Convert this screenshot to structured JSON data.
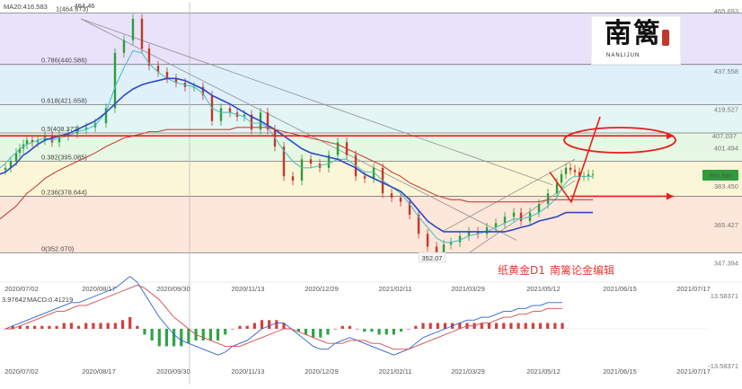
{
  "chart_data": {
    "type": "line",
    "instrument_caption": "纸黄金D1",
    "editor_caption": "南篱论金编辑",
    "logo": {
      "glyph_1": "南",
      "glyph_2": "篱",
      "subtitle": "NANLIJUN"
    },
    "ma_label": "MA20:416.583",
    "x_dates": [
      "2020/07/02",
      "2020/08/17",
      "2020/09/30",
      "2020/11/13",
      "2020/12/29",
      "2021/02/11",
      "2021/03/29",
      "2021/05/12",
      "2021/06/15",
      "2021/07/17"
    ],
    "y_ticks_right": [
      "465.693",
      "437.558",
      "419.527",
      "401.494",
      "383.450",
      "365.427",
      "347.394"
    ],
    "ylim": [
      340,
      470
    ],
    "last_price": "388.560",
    "mark_level": "407.037",
    "peak_label": "464.46",
    "trough_label": "352.07",
    "fib_levels": [
      {
        "label": "1(464.673)",
        "value": 464.673
      },
      {
        "label": "0.786(440.586)",
        "value": 440.586
      },
      {
        "label": "0.618(421.658)",
        "value": 421.658
      },
      {
        "label": "0.5(408.372)",
        "value": 408.372
      },
      {
        "label": "0.382(395.085)",
        "value": 395.085
      },
      {
        "label": "0.236(378.644)",
        "value": 378.644
      },
      {
        "label": "0(352.070)",
        "value": 352.07
      }
    ],
    "fib_bands": [
      {
        "from": 440.586,
        "to": 464.673,
        "color": "#e9e2fb"
      },
      {
        "from": 421.658,
        "to": 440.586,
        "color": "#dff0fb"
      },
      {
        "from": 408.372,
        "to": 421.658,
        "color": "#e3f5f4"
      },
      {
        "from": 395.085,
        "to": 408.372,
        "color": "#e6f7e3"
      },
      {
        "from": 378.644,
        "to": 395.085,
        "color": "#fcf6d8"
      },
      {
        "from": 352.07,
        "to": 378.644,
        "color": "#fde6da"
      }
    ],
    "price_series": {
      "name": "price",
      "x": [
        0,
        6,
        12,
        18,
        22,
        26,
        30,
        36,
        42,
        50,
        58,
        66,
        76,
        86,
        96,
        106,
        118,
        128,
        138,
        148,
        158,
        166,
        176,
        186,
        196,
        206,
        216,
        226,
        236,
        246,
        256,
        264,
        272,
        280,
        290,
        298,
        306,
        316,
        326,
        336,
        346,
        356,
        366,
        376,
        386,
        396,
        406,
        416,
        426,
        436,
        446,
        456,
        466,
        476,
        486,
        494,
        502,
        512,
        522,
        532,
        542,
        552,
        562,
        572,
        580,
        590,
        600,
        610,
        620,
        625,
        630,
        635,
        640,
        645,
        650,
        655,
        660
      ],
      "values": [
        391,
        392,
        395,
        399,
        401,
        403,
        405,
        404,
        405,
        407,
        404,
        407,
        408,
        410,
        411,
        413,
        420,
        446,
        452,
        462,
        448,
        440,
        437,
        434,
        432,
        430,
        430,
        426,
        414,
        420,
        418,
        416,
        417,
        410,
        418,
        410,
        402,
        388,
        386,
        396,
        394,
        392,
        398,
        404,
        398,
        388,
        387,
        392,
        380,
        378,
        376,
        370,
        361,
        355,
        352,
        356,
        357,
        360,
        362,
        361,
        364,
        366,
        369,
        371,
        367,
        371,
        375,
        380,
        385,
        389,
        392,
        391,
        390,
        388,
        388,
        389,
        389
      ]
    },
    "ma_series": [
      {
        "name": "MA20",
        "color": "#4cc3c0",
        "values": [
          392,
          394,
          397,
          399,
          401,
          402,
          403,
          404,
          405,
          406,
          405,
          406,
          407,
          409,
          410,
          412,
          418,
          430,
          439,
          447,
          446,
          441,
          437,
          434,
          432,
          431,
          430,
          427,
          420,
          418,
          418,
          417,
          416,
          413,
          413,
          411,
          406,
          400,
          395,
          392,
          392,
          393,
          394,
          396,
          396,
          393,
          390,
          390,
          386,
          383,
          380,
          375,
          369,
          364,
          359,
          357,
          357,
          358,
          360,
          361,
          362,
          364,
          366,
          368,
          368,
          369,
          371,
          374,
          378,
          382,
          385,
          387,
          388,
          388,
          388,
          388,
          388
        ]
      },
      {
        "name": "MA60",
        "color": "#2f48c8",
        "values": [
          389,
          390,
          392,
          394,
          396,
          398,
          399,
          401,
          403,
          405,
          406,
          407,
          408,
          410,
          412,
          414,
          418,
          422,
          426,
          429,
          431,
          432,
          433,
          434,
          434,
          433,
          431,
          429,
          426,
          424,
          422,
          420,
          418,
          416,
          414,
          412,
          410,
          407,
          404,
          401,
          399,
          398,
          397,
          396,
          394,
          392,
          389,
          387,
          385,
          383,
          381,
          377,
          372,
          367,
          364,
          362,
          362,
          362,
          362,
          362,
          362,
          362,
          362,
          363,
          364,
          365,
          367,
          368,
          369,
          370,
          371,
          371,
          371,
          371,
          371,
          371,
          371
        ]
      },
      {
        "name": "MA120",
        "color": "#c6443c",
        "values": [
          368,
          370,
          372,
          374,
          376,
          378,
          380,
          382,
          384,
          387,
          389,
          391,
          393,
          395,
          397,
          399,
          402,
          404,
          406,
          407,
          408,
          409,
          409,
          410,
          410,
          410,
          410,
          410,
          410,
          410,
          410,
          411,
          411,
          411,
          411,
          411,
          410,
          409,
          408,
          407,
          406,
          405,
          404,
          403,
          401,
          399,
          397,
          395,
          393,
          390,
          388,
          385,
          383,
          381,
          379,
          378,
          377,
          377,
          376,
          376,
          376,
          376,
          376,
          376,
          376,
          376,
          376,
          377,
          377,
          377,
          377,
          377,
          377,
          377,
          377,
          377,
          377
        ]
      }
    ],
    "trend_lines": [
      {
        "name": "down-trendline",
        "from": [
          90,
          462
        ],
        "to": [
          615,
          384
        ]
      },
      {
        "name": "down-trendline-2",
        "from": [
          90,
          462
        ],
        "to": [
          575,
          358
        ]
      },
      {
        "name": "channel-upper",
        "from": [
          492,
          362
        ],
        "to": [
          640,
          396
        ]
      },
      {
        "name": "channel-lower",
        "from": [
          522,
          352
        ],
        "to": [
          640,
          386
        ]
      }
    ],
    "red_arrows": [
      {
        "name": "arrow-upper",
        "from": [
          0,
          407.037
        ],
        "to": [
          750,
          407.037
        ]
      },
      {
        "name": "arrow-lower",
        "from": [
          635,
          378.644
        ],
        "to": [
          750,
          378.644
        ]
      }
    ],
    "macd": {
      "legend": "MACD:0.41219",
      "legend_prefix": "3.97642",
      "y_ticks": [
        "13.58371",
        "-13.58371"
      ],
      "ylim": [
        -13.58371,
        13.58371
      ],
      "dif": [
        0,
        1,
        2,
        3,
        4,
        5,
        6,
        7,
        8,
        9,
        9,
        10,
        11,
        12,
        13,
        14,
        16,
        18,
        16,
        12,
        8,
        4,
        1,
        -2,
        -4,
        -5,
        -6,
        -7,
        -8,
        -9,
        -8,
        -6,
        -5,
        -4,
        -2,
        0,
        1,
        2,
        2,
        0,
        -2,
        -4,
        -6,
        -7,
        -7,
        -5,
        -4,
        -3,
        -4,
        -5,
        -6,
        -7,
        -8,
        -9,
        -8,
        -7,
        -5,
        -3,
        -2,
        -1,
        0,
        1,
        2,
        3,
        3,
        4,
        4,
        5,
        6,
        6,
        7,
        7,
        8,
        8,
        9,
        9,
        9
      ],
      "dea": [
        0,
        0,
        1,
        2,
        3,
        4,
        5,
        6,
        6,
        7,
        8,
        8,
        9,
        10,
        11,
        12,
        13,
        14,
        15,
        14,
        12,
        10,
        7,
        4,
        2,
        0,
        -2,
        -3,
        -4,
        -5,
        -6,
        -6,
        -6,
        -5,
        -4,
        -3,
        -2,
        -1,
        0,
        0,
        -1,
        -2,
        -3,
        -4,
        -5,
        -5,
        -5,
        -4,
        -4,
        -4,
        -5,
        -5,
        -6,
        -7,
        -7,
        -7,
        -6,
        -5,
        -4,
        -3,
        -2,
        -1,
        0,
        1,
        1,
        2,
        2,
        3,
        4,
        4,
        5,
        5,
        6,
        6,
        7,
        7,
        7
      ],
      "hist": [
        0,
        1,
        1,
        1,
        1,
        1,
        1,
        1,
        2,
        2,
        1,
        2,
        2,
        2,
        2,
        2,
        3,
        4,
        1,
        -2,
        -4,
        -6,
        -6,
        -6,
        -6,
        -5,
        -4,
        -4,
        -4,
        -4,
        -2,
        0,
        1,
        1,
        2,
        3,
        3,
        3,
        2,
        0,
        -1,
        -2,
        -3,
        -3,
        -2,
        0,
        1,
        1,
        0,
        -1,
        -1,
        -2,
        -2,
        -2,
        -1,
        0,
        1,
        2,
        2,
        2,
        2,
        2,
        2,
        2,
        2,
        2,
        2,
        2,
        2,
        2,
        2,
        2,
        2,
        2,
        2,
        2,
        2
      ]
    },
    "xlabel": "",
    "ylabel": ""
  },
  "colors": {
    "fib_line": "#7a7a7a",
    "up_candle": "#2e9d3a",
    "down_candle": "#c0392b",
    "macd_pos": "#d93c3c",
    "macd_neg": "#2fa34a",
    "dif": "#2a62d1",
    "dea": "#d84a4a",
    "trend": "#999999",
    "annotation": "#e81e1e"
  }
}
